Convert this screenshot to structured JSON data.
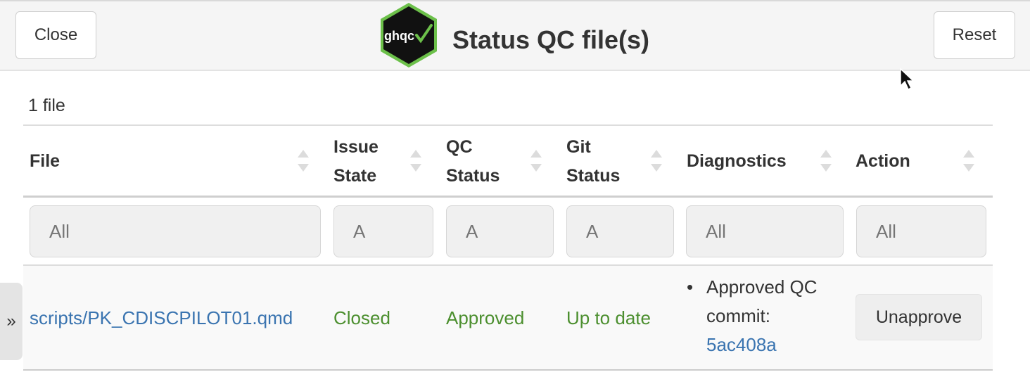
{
  "header": {
    "close_label": "Close",
    "reset_label": "Reset",
    "logo_text": "ghqc",
    "title": "Status QC file(s)"
  },
  "file_count": "1 file",
  "table": {
    "columns": [
      {
        "label": "File"
      },
      {
        "label": "Issue State"
      },
      {
        "label": "QC Status"
      },
      {
        "label": "Git Status"
      },
      {
        "label": "Diagnostics"
      },
      {
        "label": "Action"
      }
    ],
    "filters": [
      "All",
      "A",
      "A",
      "A",
      "All",
      "All"
    ],
    "rows": [
      {
        "file": "scripts/PK_CDISCPILOT01.qmd",
        "issue_state": "Closed",
        "qc_status": "Approved",
        "git_status": "Up to date",
        "diagnostics": {
          "text": "Approved QC commit:",
          "commit": "5ac408a"
        },
        "action": "Unapprove"
      }
    ]
  },
  "sidebar_toggle": "»",
  "icons": {
    "logo": "ghqc-hex-logo",
    "cursor": "mouse-pointer-icon",
    "sort": "sort-arrows-icon"
  },
  "colors": {
    "link": "#3a74b0",
    "status_green": "#4c8f2f",
    "logo_green": "#6cc04a"
  }
}
